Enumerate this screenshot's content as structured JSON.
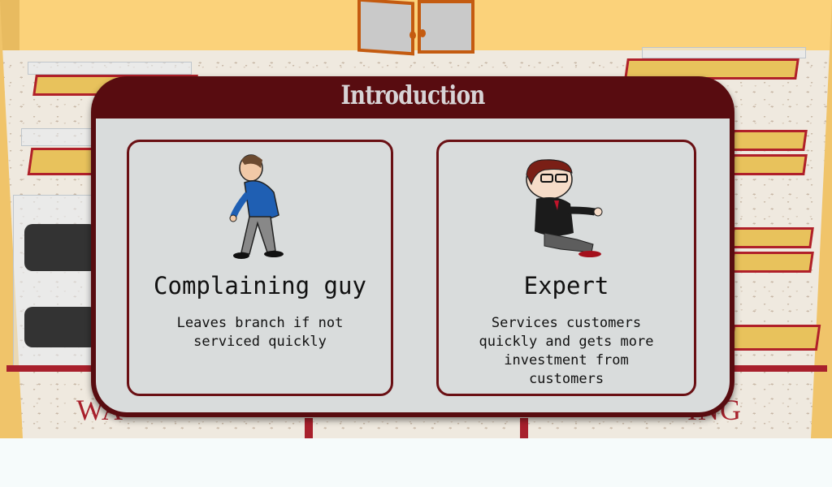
{
  "dialog": {
    "title": "Introduction"
  },
  "background": {
    "floor_left_text": "WA",
    "floor_right_text": "ING"
  },
  "cards": [
    {
      "name": "Complaining guy",
      "description": "Leaves branch if not serviced quickly",
      "image_icon": "complaining-guy-character"
    },
    {
      "name": "Expert",
      "description": "Services customers quickly and gets more investment from customers",
      "image_icon": "expert-character"
    }
  ],
  "colors": {
    "dialog_frame": "#580c10",
    "dialog_body": "#d9dcdc",
    "wall": "#fbd27a",
    "accent_red": "#a8202c"
  }
}
